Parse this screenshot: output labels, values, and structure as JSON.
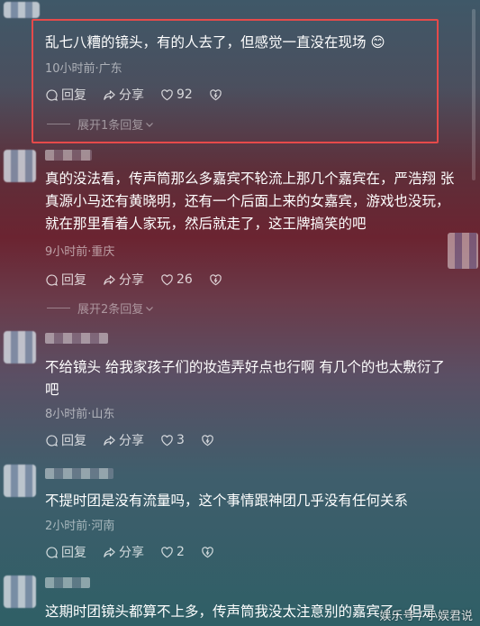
{
  "comments": [
    {
      "text": "乱七八糟的镜头，有的人去了，但感觉一直没在现场 😊",
      "meta": "10小时前·广东",
      "reply_label": "回复",
      "share_label": "分享",
      "likes": "92",
      "expand_label": "展开1条回复"
    },
    {
      "text": "真的没法看，传声筒那么多嘉宾不轮流上那几个嘉宾在，严浩翔 张真源小马还有黄晓明，还有一个后面上来的女嘉宾，游戏也没玩，就在那里看着人家玩，然后就走了，这王牌搞笑的吧",
      "meta": "9小时前·重庆",
      "reply_label": "回复",
      "share_label": "分享",
      "likes": "26",
      "expand_label": "展开2条回复"
    },
    {
      "text": "不给镜头 给我家孩子们的妆造弄好点也行啊 有几个的也太敷衍了吧",
      "meta": "8小时前·山东",
      "reply_label": "回复",
      "share_label": "分享",
      "likes": "3"
    },
    {
      "text": "不提时团是没有流量吗，这个事情跟神团几乎没有任何关系",
      "meta": "2小时前·河南",
      "reply_label": "回复",
      "share_label": "分享",
      "likes": "2"
    },
    {
      "text": "这期时团镜头都算不上多，传声筒我没太注意别的嘉宾了，但是"
    }
  ],
  "watermark": "娱乐号 / 小娱君说",
  "colors": {
    "highlight_border": "#e64a4a"
  },
  "icons": [
    "reply-icon",
    "share-icon",
    "like-heart-icon",
    "dislike-heart-icon",
    "chevron-down-icon"
  ]
}
